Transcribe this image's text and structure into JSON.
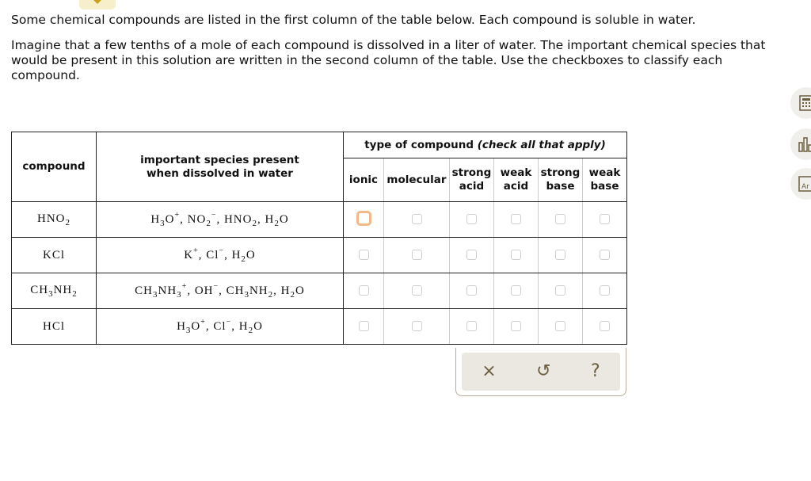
{
  "intro": {
    "p1": "Some chemical compounds are listed in the first column of the table below. Each compound is soluble in water.",
    "p2": "Imagine that a few tenths of a mole of each compound is dissolved in a liter of water. The important chemical species that would be present in this solution are written in the second column of the table. Use the checkboxes to classify each compound."
  },
  "table": {
    "headers": {
      "compound": "compound",
      "species": "important species present when dissolved in water",
      "type_main": "type of compound",
      "type_note": "(check all that apply)",
      "types": [
        "ionic",
        "molecular",
        "strong acid",
        "weak acid",
        "strong base",
        "weak base"
      ]
    },
    "rows": [
      {
        "compound": "HNO2",
        "species": "H3O+, NO2−, HNO2, H2O",
        "checked": [
          false,
          false,
          false,
          false,
          false,
          false
        ],
        "focused": 0
      },
      {
        "compound": "KCl",
        "species": "K+, Cl−, H2O",
        "checked": [
          false,
          false,
          false,
          false,
          false,
          false
        ]
      },
      {
        "compound": "CH3NH2",
        "species": "CH3NH3+, OH−, CH3NH2, H2O",
        "checked": [
          false,
          false,
          false,
          false,
          false,
          false
        ]
      },
      {
        "compound": "HCl",
        "species": "H3O+, Cl−, H2O",
        "checked": [
          false,
          false,
          false,
          false,
          false,
          false
        ]
      }
    ]
  },
  "actions": {
    "clear": "×",
    "undo": "↺",
    "help": "?"
  },
  "sidebar": [
    "calculator-icon",
    "chart-icon",
    "periodic-table-icon"
  ],
  "colors": {
    "focus": "#f3b888",
    "action_bg": "#ebe8e1",
    "action_icon": "#6b5d3f"
  }
}
